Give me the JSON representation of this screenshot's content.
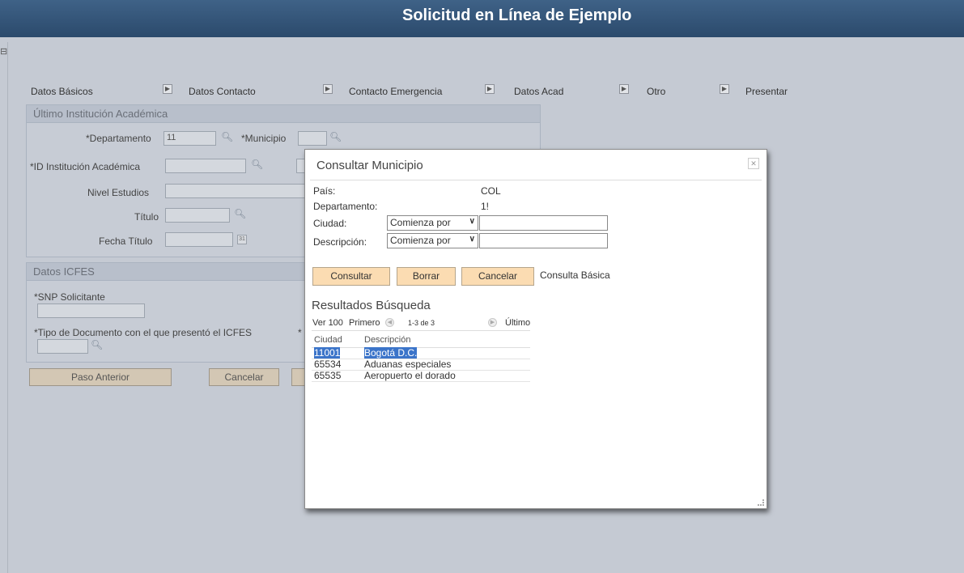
{
  "header": {
    "title": "Solicitud en Línea de Ejemplo"
  },
  "steps": [
    {
      "label": "Datos Básicos"
    },
    {
      "label": "Datos Contacto"
    },
    {
      "label": "Contacto Emergencia"
    },
    {
      "label": "Datos Acad"
    },
    {
      "label": "Otro"
    },
    {
      "label": "Presentar"
    }
  ],
  "academic": {
    "title": "Último Institución Académica",
    "departamento_label": "*Departamento",
    "departamento_value": "11",
    "municipio_label": "*Municipio",
    "institucion_label": "*ID Institución Académica",
    "nivel_label": "Nivel Estudios",
    "titulo_label": "Título",
    "fecha_label": "Fecha Título"
  },
  "icfes": {
    "title": "Datos ICFES",
    "snp_label": "*SNP Solicitante",
    "tipo_doc_label": "*Tipo de Documento con el que presentó el ICFES",
    "extra_label": "*"
  },
  "buttons": {
    "back": "Paso Anterior",
    "cancel": "Cancelar"
  },
  "modal": {
    "title": "Consultar Municipio",
    "close_icon": "close-icon",
    "pais_label": "País:",
    "pais_value": "COL",
    "departamento_label": "Departamento:",
    "departamento_value": "1!",
    "ciudad_label": "Ciudad:",
    "descripcion_label": "Descripción:",
    "operator": "Comienza por",
    "consultar": "Consultar",
    "borrar": "Borrar",
    "cancelar": "Cancelar",
    "basic_search": "Consulta Básica",
    "results_title": "Resultados Búsqueda",
    "nav": {
      "view": "Ver 100",
      "first": "Primero",
      "range": "1-3 de 3",
      "last": "Último"
    },
    "columns": [
      "Ciudad",
      "Descripción"
    ],
    "rows": [
      {
        "ciudad": "11001",
        "descripcion": "Bogotá D.C."
      },
      {
        "ciudad": "65534",
        "descripcion": "Aduanas especiales"
      },
      {
        "ciudad": "65535",
        "descripcion": "Aeropuerto el dorado"
      }
    ]
  }
}
